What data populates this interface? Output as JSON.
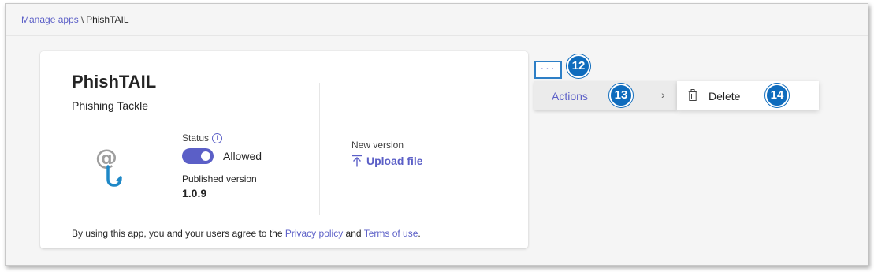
{
  "breadcrumb": {
    "manage_apps": "Manage apps",
    "separator": "\\",
    "current": "PhishTAIL"
  },
  "app": {
    "title": "PhishTAIL",
    "subtitle": "Phishing Tackle",
    "logo_icon": "at-sign-fishhook-icon",
    "status_label": "Status",
    "info_glyph": "i",
    "toggle_state": "on",
    "toggle_label": "Allowed",
    "published_label": "Published version",
    "published_value": "1.0.9",
    "new_version_label": "New version",
    "upload_label": "Upload file"
  },
  "footer": {
    "prefix": "By using this app, you and your users agree to the",
    "privacy": "Privacy policy",
    "and": "and",
    "terms": "Terms of use",
    "suffix": "."
  },
  "more_button": {
    "glyph": "···"
  },
  "menu": {
    "actions_label": "Actions",
    "chevron": "›",
    "delete_label": "Delete"
  },
  "badges": {
    "b12": "12",
    "b13": "13",
    "b14": "14"
  },
  "colors": {
    "accent": "#5b5fc7",
    "badge": "#0f6cbd",
    "logo_at": "#9e9e9e",
    "logo_hook": "#1e88c7"
  }
}
